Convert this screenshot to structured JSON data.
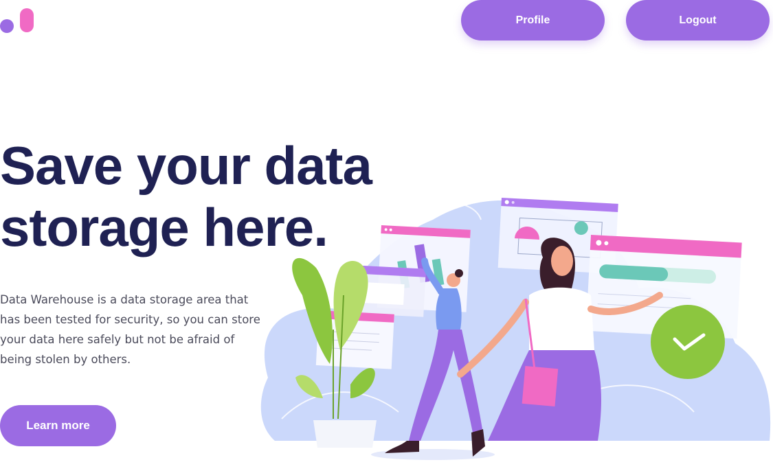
{
  "header": {
    "profile_label": "Profile",
    "logout_label": "Logout"
  },
  "hero": {
    "title_line1": "Save your data",
    "title_line2": "storage here.",
    "description_line1": "Data Warehouse is a data storage area that",
    "description_line2": "has been  tested for security, so you can store",
    "description_line3": "your data here  safely but not be afraid of",
    "description_line4": "being stolen by others.",
    "cta_label": "Learn more"
  },
  "colors": {
    "primary": "#9b6be3",
    "accent_pink": "#f06ac4",
    "heading": "#1f2153",
    "success": "#8cc63f"
  }
}
